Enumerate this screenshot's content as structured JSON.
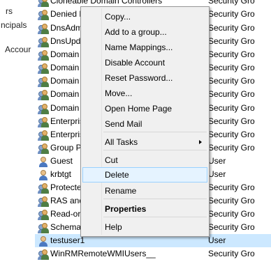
{
  "left_pane": {
    "fragments": [
      "rs",
      "ncipals",
      "Accour"
    ]
  },
  "list": {
    "rows": [
      {
        "name": "Cloneable Domain Controllers",
        "type": "Security Gro",
        "icon": "group-icon"
      },
      {
        "name": "Denied R",
        "type": "Security Gro",
        "icon": "group-icon"
      },
      {
        "name": "DnsAdmi",
        "type": "Security Gro",
        "icon": "group-icon"
      },
      {
        "name": "DnsUpd",
        "type": "Security Gro",
        "icon": "group-icon"
      },
      {
        "name": "Domain",
        "type": "Security Gro",
        "icon": "group-icon"
      },
      {
        "name": "Domain",
        "type": "Security Gro",
        "icon": "group-icon"
      },
      {
        "name": "Domain",
        "type": "Security Gro",
        "icon": "group-icon"
      },
      {
        "name": "Domain",
        "type": "Security Gro",
        "icon": "group-icon"
      },
      {
        "name": "Domain",
        "type": "Security Gro",
        "icon": "group-icon"
      },
      {
        "name": "Enterpris",
        "type": "Security Gro",
        "icon": "group-icon"
      },
      {
        "name": "Enterpris",
        "type": "Security Gro",
        "icon": "group-icon"
      },
      {
        "name": "Group P",
        "type": "Security Gro",
        "icon": "group-icon"
      },
      {
        "name": "Guest",
        "type": "User",
        "icon": "user-icon"
      },
      {
        "name": "krbtgt",
        "type": "User",
        "icon": "user-icon"
      },
      {
        "name": "Protecte",
        "type": "Security Gro",
        "icon": "group-icon"
      },
      {
        "name": "RAS and",
        "type": "Security Gro",
        "icon": "group-icon"
      },
      {
        "name": "Read-or",
        "type": "Security Gro",
        "icon": "group-icon"
      },
      {
        "name": "Schema",
        "type": "Security Gro",
        "icon": "group-icon"
      },
      {
        "name": "testuser1",
        "type": "User",
        "icon": "user-icon",
        "selected": true
      },
      {
        "name": "WinRMRemoteWMIUsers__",
        "type": "Security Gro",
        "icon": "group-icon"
      }
    ]
  },
  "context_menu": {
    "items": [
      {
        "label": "Copy..."
      },
      {
        "label": "Add to a group..."
      },
      {
        "label": "Name Mappings..."
      },
      {
        "label": "Disable Account"
      },
      {
        "label": "Reset Password..."
      },
      {
        "label": "Move..."
      },
      {
        "label": "Open Home Page"
      },
      {
        "label": "Send Mail"
      },
      {
        "label": "All Tasks",
        "submenu": true
      },
      {
        "label": "Cut"
      },
      {
        "label": "Delete",
        "hover": true
      },
      {
        "label": "Rename"
      },
      {
        "label": "Properties",
        "bold": true
      },
      {
        "label": "Help"
      }
    ]
  },
  "colors": {
    "selection": "#cce8ff",
    "menu_bg": "#f0f0f0",
    "menu_hover": "#e5f3ff"
  }
}
